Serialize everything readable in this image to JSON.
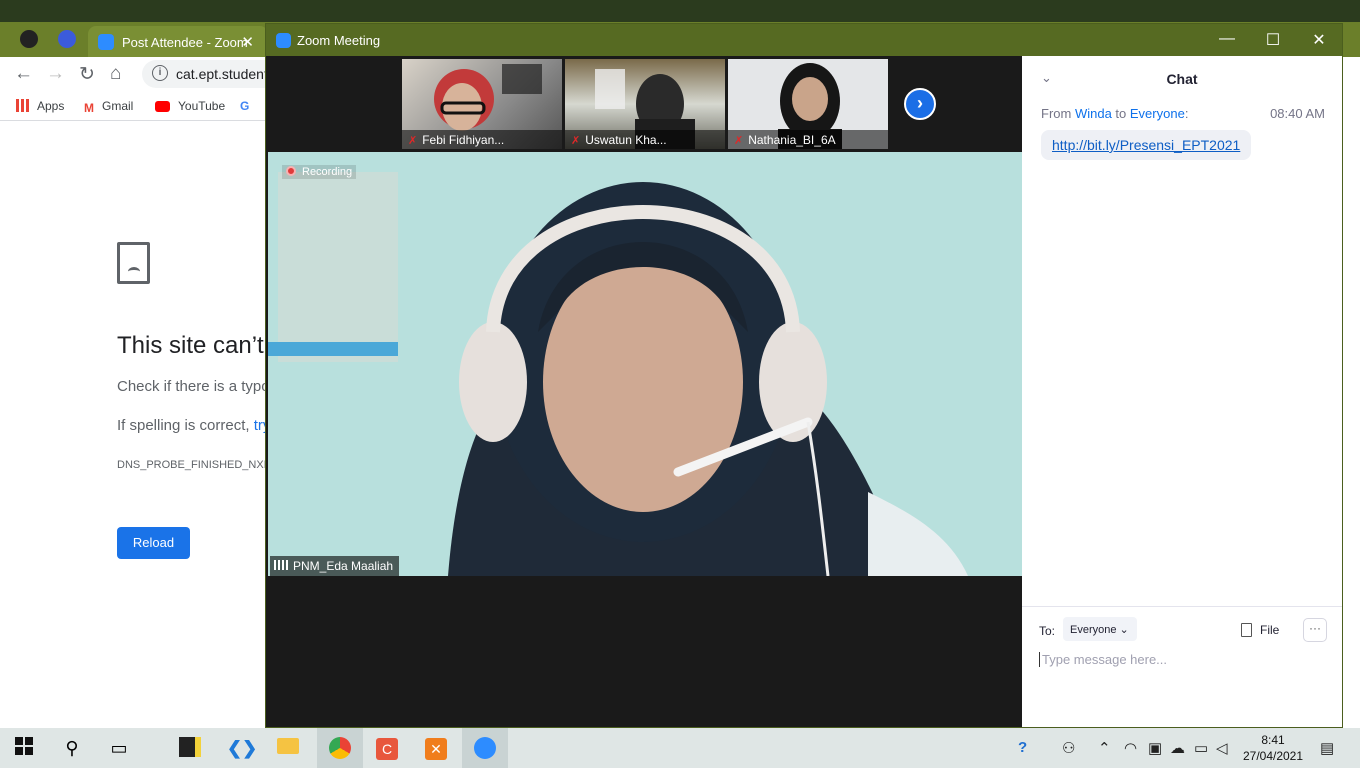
{
  "browser": {
    "tab_title": "Post Attendee - Zoom",
    "tab_close": "✕",
    "address": "cat.ept.student",
    "bookmarks": [
      {
        "label": "Apps"
      },
      {
        "label": "Gmail"
      },
      {
        "label": "YouTube"
      },
      {
        "label": "G"
      }
    ],
    "error": {
      "title": "This site can’t",
      "line1": "Check if there is a typo",
      "line2_prefix": "If spelling is correct, ",
      "line2_link": "try",
      "code": "DNS_PROBE_FINISHED_NXD",
      "reload_label": "Reload"
    }
  },
  "zoom": {
    "window_title": "Zoom Meeting",
    "participants": [
      {
        "name": "Febi Fidhiyan...",
        "muted": true
      },
      {
        "name": "Uswatun Kha...",
        "muted": true
      },
      {
        "name": "Nathania_BI_6A",
        "muted": true
      }
    ],
    "recording_label": "Recording",
    "active_speaker": "PNM_Eda Maaliah",
    "chat": {
      "title": "Chat",
      "message": {
        "from_prefix": "From ",
        "sender": "Winda",
        "to_word": " to ",
        "recipient": "Everyone",
        "suffix": ":",
        "time": "08:40 AM",
        "text": "http://bit.ly/Presensi_EPT2021"
      },
      "to_label": "To:",
      "to_value": "Everyone",
      "file_label": "File",
      "more_label": "···",
      "input_placeholder": "Type message here..."
    }
  },
  "taskbar": {
    "time": "8:41",
    "date": "27/04/2021"
  }
}
